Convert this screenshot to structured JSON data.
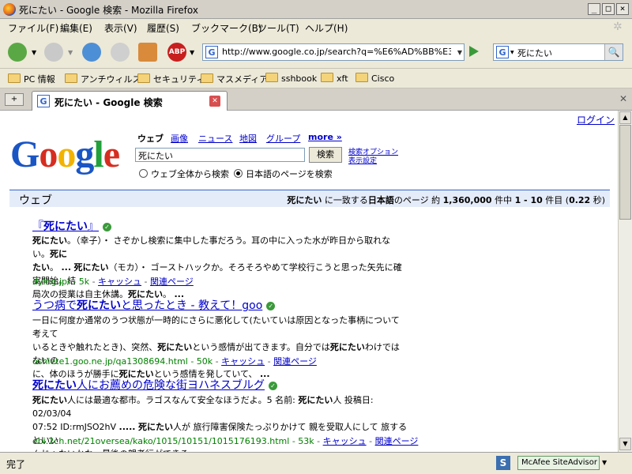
{
  "window": {
    "title": "死にたい - Google 検索 - Mozilla Firefox"
  },
  "menu": [
    "ファイル(F)",
    "編集(E)",
    "表示(V)",
    "履歴(S)",
    "ブックマーク(B)",
    "ツール(T)",
    "ヘルプ(H)"
  ],
  "toolbar": {
    "url": "http://www.google.co.jp/search?q=%E6%AD%BB%E3%81%A",
    "search_engine_letter": "G",
    "search_value": "死にたい",
    "abp_label": "ABP"
  },
  "bookmarks": [
    "PC 情報",
    "アンチウィルス",
    "セキュリティ",
    "マスメディア",
    "sshbook",
    "xft",
    "Cisco"
  ],
  "tab": {
    "label": "死にたい - Google 検索",
    "letter": "G"
  },
  "google": {
    "login": "ログイン",
    "logo_letters": [
      "G",
      "o",
      "o",
      "g",
      "l",
      "e"
    ],
    "logo_colors": [
      "#1a55c4",
      "#d62d20",
      "#f2b300",
      "#1a55c4",
      "#22a03b",
      "#d62d20"
    ],
    "tabs": {
      "web": "ウェブ",
      "images": "画像",
      "news": "ニュース",
      "maps": "地図",
      "groups": "グループ",
      "more": "more »"
    },
    "query": "死にたい",
    "search_button": "検索",
    "options_1": "検索オプション",
    "options_2": "表示設定",
    "radio_all": "ウェブ全体から検索",
    "radio_japanese": "日本語のページを検索",
    "results_label": "ウェブ",
    "results_summary": {
      "query": "死にたい",
      "mid": " に一致する",
      "lang": "日本語",
      "page_count_prefix": "のページ 約 ",
      "count": "1,360,000",
      "range_prefix": " 件中 ",
      "range": "1 - 10",
      "range_suffix": " 件目 (",
      "time": "0.22",
      "time_suffix": " 秒)"
    }
  },
  "results": [
    {
      "title_parts": [
        "『",
        "死にたい",
        "』"
      ],
      "snippet_lines": [
        "死にたい。（幸子）・ さぞかし検索に集中した事だろう。耳の中に入った水が昨日から取れない。死に",
        "たい。 ... 死にたい（モカ）・ ゴーストハックか。そろそろやめて学校行こうと思った矢先に確実開始。結",
        "局次の授業は自主休講。死にたい。 ..."
      ],
      "url": "dying.jp/ - 5k",
      "cache": "キャッシュ",
      "related": "関連ページ"
    },
    {
      "title_parts": [
        "うつ病で",
        "死にたい",
        "と思ったとき - 教えて！goo"
      ],
      "snippet_lines": [
        "一日に何度か通常のうつ状態が一時的にさらに悪化して(たいていは原因となった事柄について考えて",
        "いるときや触れたとき)、突然、死にたいという感情が出てきます。自分では死にたいわけではないの",
        "に、体のほうが勝手に死にたいという感情を発していて、 ..."
      ],
      "url": "oshiete1.goo.ne.jp/qa1308694.html - 50k",
      "cache": "キャッシュ",
      "related": "関連ページ"
    },
    {
      "title_parts": [
        "死にたい",
        "人にお薦めの危険な街ヨハネスブルグ",
        ""
      ],
      "snippet_lines": [
        "死にたい人には最適な都市。ラゴスなんて安全なほうだよ。5 名前: 死にたい人 投稿日: 02/03/04",
        "07:52 ID:rmJSO2hV ..... 死にたい人が 旅行障害保険たっぷりかけて 親を受取人にして 旅するといい",
        "んじゃないかな。最後の親孝行ができる。 ..."
      ],
      "url": "ebi.2ch.net/21oversea/kako/1015/10151/1015176193.html - 53k",
      "cache": "キャッシュ",
      "related": "関連ページ"
    }
  ],
  "status": {
    "text": "完了",
    "mcafee": "McAfee SiteAdvisor",
    "s_letter": "S"
  }
}
